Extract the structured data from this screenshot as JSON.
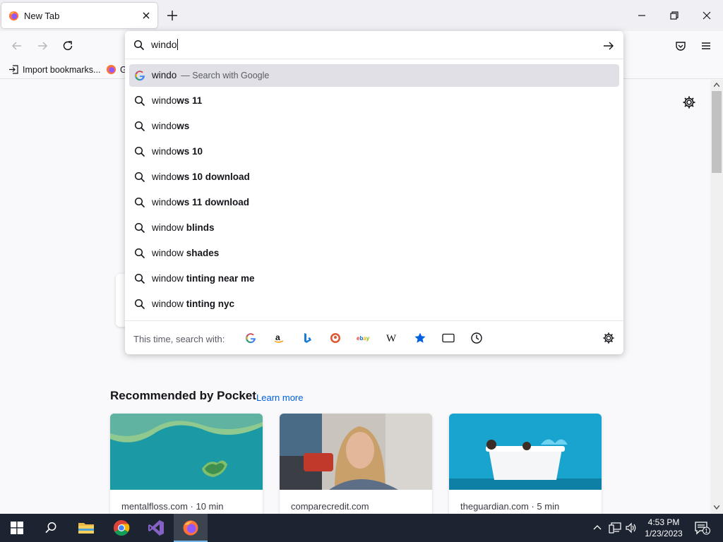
{
  "tab": {
    "title": "New Tab"
  },
  "bookmarks": {
    "import_label": "Import bookmarks...",
    "second_label": "G"
  },
  "urlbar": {
    "value": "windo",
    "suggestions": [
      {
        "typed": "windo",
        "completion": "",
        "suffix": "— Search with Google",
        "type": "google",
        "selected": true
      },
      {
        "typed": "windo",
        "completion": "ws 11",
        "type": "search"
      },
      {
        "typed": "windo",
        "completion": "ws",
        "type": "search"
      },
      {
        "typed": "windo",
        "completion": "ws 10",
        "type": "search"
      },
      {
        "typed": "windo",
        "completion": "ws 10 download",
        "type": "search"
      },
      {
        "typed": "windo",
        "completion": "ws 11 download",
        "type": "search"
      },
      {
        "typed": "window",
        "completion": " blinds",
        "type": "search"
      },
      {
        "typed": "window",
        "completion": " shades",
        "type": "search"
      },
      {
        "typed": "window",
        "completion": " tinting near me",
        "type": "search"
      },
      {
        "typed": "window",
        "completion": " tinting nyc",
        "type": "search"
      }
    ],
    "oneoff_label": "This time, search with:",
    "engines": [
      "google-icon",
      "amazon-icon",
      "bing-icon",
      "duckduckgo-icon",
      "ebay-icon",
      "wikipedia-icon",
      "bookmarks-star-icon",
      "tabs-icon",
      "history-icon"
    ]
  },
  "pocket": {
    "heading": "Recommended by Pocket",
    "learn_more": "Learn more",
    "cards": [
      {
        "source": "mentalfloss.com · 10 min"
      },
      {
        "source": "comparecredit.com"
      },
      {
        "source": "theguardian.com · 5 min"
      }
    ]
  },
  "taskbar": {
    "time": "4:53 PM",
    "date": "1/23/2023",
    "notification_count": "1"
  },
  "colors": {
    "accent": "#0061e0",
    "taskbar": "#1b2430",
    "selected_row": "#e0e0e6"
  }
}
